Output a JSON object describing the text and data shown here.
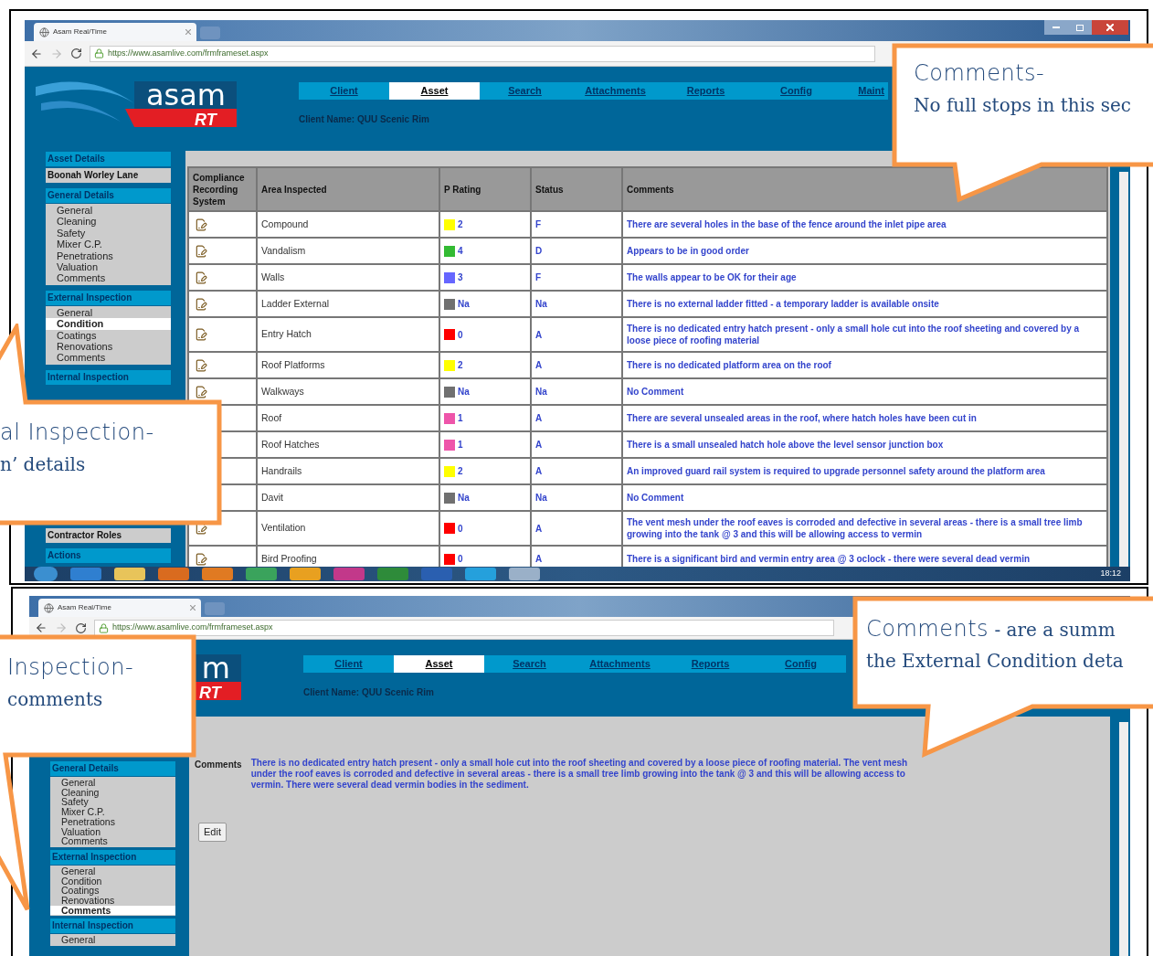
{
  "screenshots": [
    {
      "kind": "table",
      "browser": {
        "tab_title": "Asam Real/Time",
        "url": "https://www.asamlive.com/frmframeset.aspx"
      },
      "logo": {
        "word": "asam",
        "mark": "RT"
      },
      "nav": [
        {
          "label": "Client",
          "selected": false
        },
        {
          "label": "Asset",
          "selected": true
        },
        {
          "label": "Search",
          "selected": false
        },
        {
          "label": "Attachments",
          "selected": false
        },
        {
          "label": "Reports",
          "selected": false
        },
        {
          "label": "Config",
          "selected": false
        },
        {
          "label": "Maint",
          "selected": false
        }
      ],
      "client_name": "Client Name: QUU Scenic Rim",
      "sidebar": {
        "top": [
          {
            "kind": "header",
            "label": "Asset Details"
          },
          {
            "kind": "box",
            "label": "Boonah Worley Lane"
          },
          {
            "kind": "header",
            "label": "General Details"
          },
          {
            "kind": "list",
            "items": [
              {
                "label": "General",
                "selected": false
              },
              {
                "label": "Cleaning",
                "selected": false
              },
              {
                "label": "Safety",
                "selected": false
              },
              {
                "label": "Mixer C.P.",
                "selected": false
              },
              {
                "label": "Penetrations",
                "selected": false
              },
              {
                "label": "Valuation",
                "selected": false
              },
              {
                "label": "Comments",
                "selected": false
              }
            ]
          },
          {
            "kind": "header",
            "label": "External Inspection"
          },
          {
            "kind": "list",
            "items": [
              {
                "label": "General",
                "selected": false
              },
              {
                "label": "Condition",
                "selected": true
              },
              {
                "label": "Coatings",
                "selected": false
              },
              {
                "label": "Renovations",
                "selected": false
              },
              {
                "label": "Comments",
                "selected": false
              }
            ]
          },
          {
            "kind": "header",
            "label": "Internal Inspection"
          }
        ],
        "bottom": [
          {
            "kind": "box",
            "label": "Contractor Roles"
          },
          {
            "kind": "header",
            "label": "Actions"
          }
        ]
      },
      "table": {
        "columns": [
          "Compliance Recording System",
          "Area Inspected",
          "P Rating",
          "Status",
          "Comments"
        ],
        "rows": [
          {
            "area": "Compound",
            "rating": "2",
            "color": "#ffff00",
            "status": "F",
            "comment": "There are several holes in the base of the fence around the inlet pipe area"
          },
          {
            "area": "Vandalism",
            "rating": "4",
            "color": "#33bb33",
            "status": "D",
            "comment": "Appears to be in good order"
          },
          {
            "area": "Walls",
            "rating": "3",
            "color": "#6666ff",
            "status": "F",
            "comment": "The walls appear to be OK for their age"
          },
          {
            "area": "Ladder External",
            "rating": "Na",
            "color": "#707070",
            "status": "Na",
            "comment": "There is no external ladder fitted - a temporary ladder is available onsite"
          },
          {
            "area": "Entry Hatch",
            "rating": "0",
            "color": "#ff0000",
            "status": "A",
            "comment": "There is no dedicated entry hatch present - only a small hole cut into the roof sheeting and covered by a loose piece of roofing material"
          },
          {
            "area": "Roof Platforms",
            "rating": "2",
            "color": "#ffff00",
            "status": "A",
            "comment": "There is no dedicated platform area on the roof"
          },
          {
            "area": "Walkways",
            "rating": "Na",
            "color": "#707070",
            "status": "Na",
            "comment": "No Comment"
          },
          {
            "area": "Roof",
            "rating": "1",
            "color": "#ee55aa",
            "status": "A",
            "comment": "There are several unsealed areas in the roof, where hatch holes have been cut in"
          },
          {
            "area": "Roof Hatches",
            "rating": "1",
            "color": "#ee55aa",
            "status": "A",
            "comment": "There is a small unsealed hatch hole above the level sensor junction box"
          },
          {
            "area": "Handrails",
            "rating": "2",
            "color": "#ffff00",
            "status": "A",
            "comment": "An improved guard rail system is required to upgrade personnel safety around the platform area"
          },
          {
            "area": "Davit",
            "rating": "Na",
            "color": "#707070",
            "status": "Na",
            "comment": "No Comment"
          },
          {
            "area": "Ventilation",
            "rating": "0",
            "color": "#ff0000",
            "status": "A",
            "comment": "The vent mesh under the roof eaves is corroded and defective in several areas - there is a small tree limb growing into the tank @ 3 and this will be allowing access to vermin"
          },
          {
            "area": "Bird Proofing",
            "rating": "0",
            "color": "#ff0000",
            "status": "A",
            "comment": "There is a significant bird and vermin entry area @ 3 oclock - there were several dead vermin"
          }
        ]
      },
      "taskbar": {
        "time": "18:12"
      }
    },
    {
      "kind": "comments",
      "browser": {
        "tab_title": "Asam Real/Time",
        "url": "https://www.asamlive.com/frmframeset.aspx"
      },
      "logo": {
        "word": "m",
        "mark": "RT"
      },
      "nav": [
        {
          "label": "Client",
          "selected": false
        },
        {
          "label": "Asset",
          "selected": true
        },
        {
          "label": "Search",
          "selected": false
        },
        {
          "label": "Attachments",
          "selected": false
        },
        {
          "label": "Reports",
          "selected": false
        },
        {
          "label": "Config",
          "selected": false
        }
      ],
      "client_name": "Client Name: QUU Scenic Rim",
      "sidebar": {
        "top": [
          {
            "kind": "header",
            "label": "General Details"
          },
          {
            "kind": "list",
            "items": [
              {
                "label": "General",
                "selected": false
              },
              {
                "label": "Cleaning",
                "selected": false
              },
              {
                "label": "Safety",
                "selected": false
              },
              {
                "label": "Mixer C.P.",
                "selected": false
              },
              {
                "label": "Penetrations",
                "selected": false
              },
              {
                "label": "Valuation",
                "selected": false
              },
              {
                "label": "Comments",
                "selected": false
              }
            ]
          },
          {
            "kind": "header",
            "label": "External Inspection"
          },
          {
            "kind": "list",
            "items": [
              {
                "label": "General",
                "selected": false
              },
              {
                "label": "Condition",
                "selected": false
              },
              {
                "label": "Coatings",
                "selected": false
              },
              {
                "label": "Renovations",
                "selected": false
              },
              {
                "label": "Comments",
                "selected": true
              }
            ]
          },
          {
            "kind": "header",
            "label": "Internal Inspection"
          },
          {
            "kind": "list",
            "items": [
              {
                "label": "General",
                "selected": false
              }
            ]
          }
        ]
      },
      "comments": {
        "label": "Comments",
        "text": "There is no dedicated entry hatch present - only a small hole cut into the roof sheeting and covered by a loose piece of roofing material. The vent mesh under the roof eaves is corroded and defective in several areas - there is a small tree limb growing into the tank @ 3 and this will be allowing access to vermin. There were several dead vermin bodies in the sediment.",
        "button": "Edit"
      }
    }
  ],
  "callouts": [
    {
      "lines": [
        [
          {
            "kind": "heading",
            "text": "Comments-"
          }
        ],
        [
          {
            "kind": "body",
            "text": "No full stops in this sec"
          }
        ]
      ]
    },
    {
      "lines": [
        [
          {
            "kind": "heading",
            "text": "al Inspection-"
          }
        ],
        [
          {
            "kind": "body",
            "text": "n’ details"
          }
        ]
      ]
    },
    {
      "lines": [
        [
          {
            "kind": "heading",
            "text": "Inspection-"
          }
        ],
        [
          {
            "kind": "body",
            "text": "comments"
          }
        ]
      ]
    },
    {
      "lines": [
        [
          {
            "kind": "heading",
            "text": "Comments"
          },
          {
            "kind": "body",
            "text": " - are a summ"
          }
        ],
        [
          {
            "kind": "body",
            "text": "the External Condition deta"
          }
        ]
      ]
    }
  ]
}
